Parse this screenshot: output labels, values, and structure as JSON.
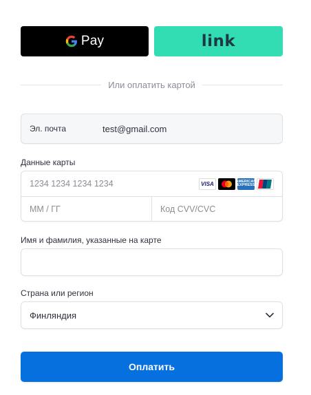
{
  "wallets": {
    "gpay_label": "Pay",
    "link_label": "link"
  },
  "divider": {
    "text": "Или оплатить картой"
  },
  "email": {
    "label": "Эл. почта",
    "value": "test@gmail.com"
  },
  "card": {
    "section_label": "Данные карты",
    "number_placeholder": "1234 1234 1234 1234",
    "expiry_placeholder": "MM / ГГ",
    "cvc_placeholder": "Код CVV/CVC",
    "brands": {
      "visa": "VISA",
      "amex": "AMERICAN EXPRESS"
    }
  },
  "cardholder": {
    "label": "Имя и фамилия, указанные на карте",
    "value": ""
  },
  "country": {
    "label": "Страна или регион",
    "selected": "Финляндия"
  },
  "pay_button": {
    "label": "Оплатить"
  },
  "colors": {
    "gpay_bg": "#000000",
    "link_bg": "#33ddb3",
    "link_text": "#1d3944",
    "pay_button_bg": "#0570de",
    "placeholder_text": "#8a8d95",
    "border": "#e0e0e0",
    "email_bg": "#f6f7f9"
  }
}
